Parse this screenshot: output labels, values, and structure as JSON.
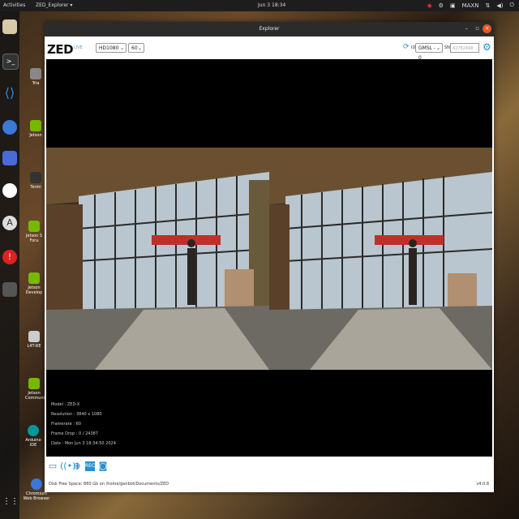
{
  "topbar": {
    "activities": "Activities",
    "app_menu": "ZED_Explorer ▾",
    "clock": "Jun 3 18:34",
    "tray_label": "MAXN"
  },
  "desktop_icons": [
    {
      "label": "Tria"
    },
    {
      "label": "Jetson"
    },
    {
      "label": "Termi"
    },
    {
      "label": "Jetson S Foru"
    },
    {
      "label": "Jetson Develop"
    },
    {
      "label": "L4T-RE"
    },
    {
      "label": "Jetson Communit"
    },
    {
      "label": "Arduino IDE"
    },
    {
      "label": "Chromium Web Browser"
    }
  ],
  "window": {
    "title": "Explorer",
    "close": "×"
  },
  "toolbar": {
    "logo": "ZED",
    "live": "LIVE",
    "resolution": "HD1080",
    "fps": "60",
    "id_label": "ID",
    "id_value": "GMSL - 0",
    "sn_label": "SN",
    "sn_placeholder": "42782498"
  },
  "info": {
    "model": "Model : ZED-X",
    "resolution": "Resolution : 3840 x 1080",
    "framerate": "Framerate : 60",
    "frame_drop": "Frame Drop : 0 / 24387",
    "date": "Date : Mon Jun 3 18:34:50 2024"
  },
  "status": {
    "disk": "Disk Free Space: 860 Gb  on /home/genbot/Documents/ZED",
    "version": "v4.0.8"
  }
}
